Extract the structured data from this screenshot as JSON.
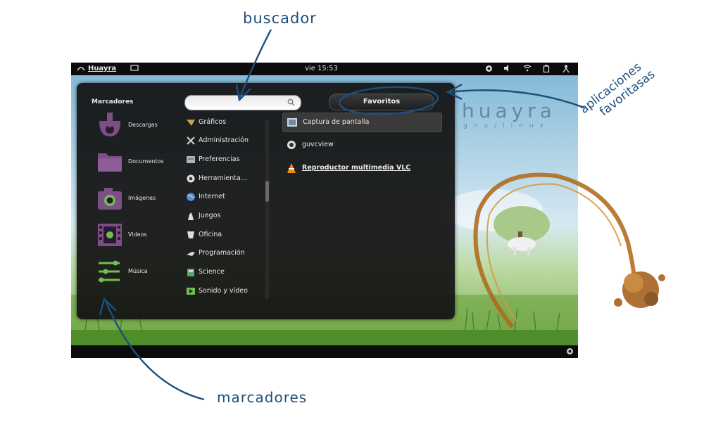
{
  "annotations": {
    "search_label": "buscador",
    "bookmarks_label": "marcadores",
    "favorites_label_line1": "aplicaciones",
    "favorites_label_line2": "favoritasas"
  },
  "topbar": {
    "activities_label": "Huayra",
    "clock": "vie 15:53"
  },
  "wallpaper": {
    "brand_text": "huayra",
    "brand_sub": "gnu/linux"
  },
  "menu": {
    "bookmarks_heading": "Marcadores",
    "bookmarks": [
      {
        "label": "Descargas",
        "icon": "download-folder-icon"
      },
      {
        "label": "Documentos",
        "icon": "documents-folder-icon"
      },
      {
        "label": "Imágenes",
        "icon": "pictures-folder-icon"
      },
      {
        "label": "Videos",
        "icon": "videos-folder-icon"
      },
      {
        "label": "Música",
        "icon": "music-folder-icon"
      }
    ],
    "search": {
      "value": "",
      "placeholder": ""
    },
    "favorites_button": "Favoritos",
    "categories": [
      {
        "label": "Gráficos",
        "icon": "graphics-icon"
      },
      {
        "label": "Administración",
        "icon": "administration-icon"
      },
      {
        "label": "Preferencias",
        "icon": "preferences-icon"
      },
      {
        "label": "Herramienta...",
        "icon": "tools-icon"
      },
      {
        "label": "Internet",
        "icon": "internet-icon"
      },
      {
        "label": "Juegos",
        "icon": "games-icon"
      },
      {
        "label": "Oficina",
        "icon": "office-icon"
      },
      {
        "label": "Programación",
        "icon": "programming-icon"
      },
      {
        "label": "Science",
        "icon": "science-icon"
      },
      {
        "label": "Sonido y vídeo",
        "icon": "sound-video-icon"
      }
    ],
    "apps": [
      {
        "label": "Captura de pantalla",
        "icon": "screenshot-icon",
        "selected": true
      },
      {
        "label": "guvcview",
        "icon": "webcam-icon",
        "selected": false
      },
      {
        "label": "Reproductor multimedia VLC",
        "icon": "vlc-icon",
        "selected": false
      }
    ]
  },
  "colors": {
    "annotation_ink": "#1d4f7c",
    "folder_purple": "#7c4f86",
    "folder_green": "#6fbf4f",
    "panel_bg": "#121212"
  }
}
